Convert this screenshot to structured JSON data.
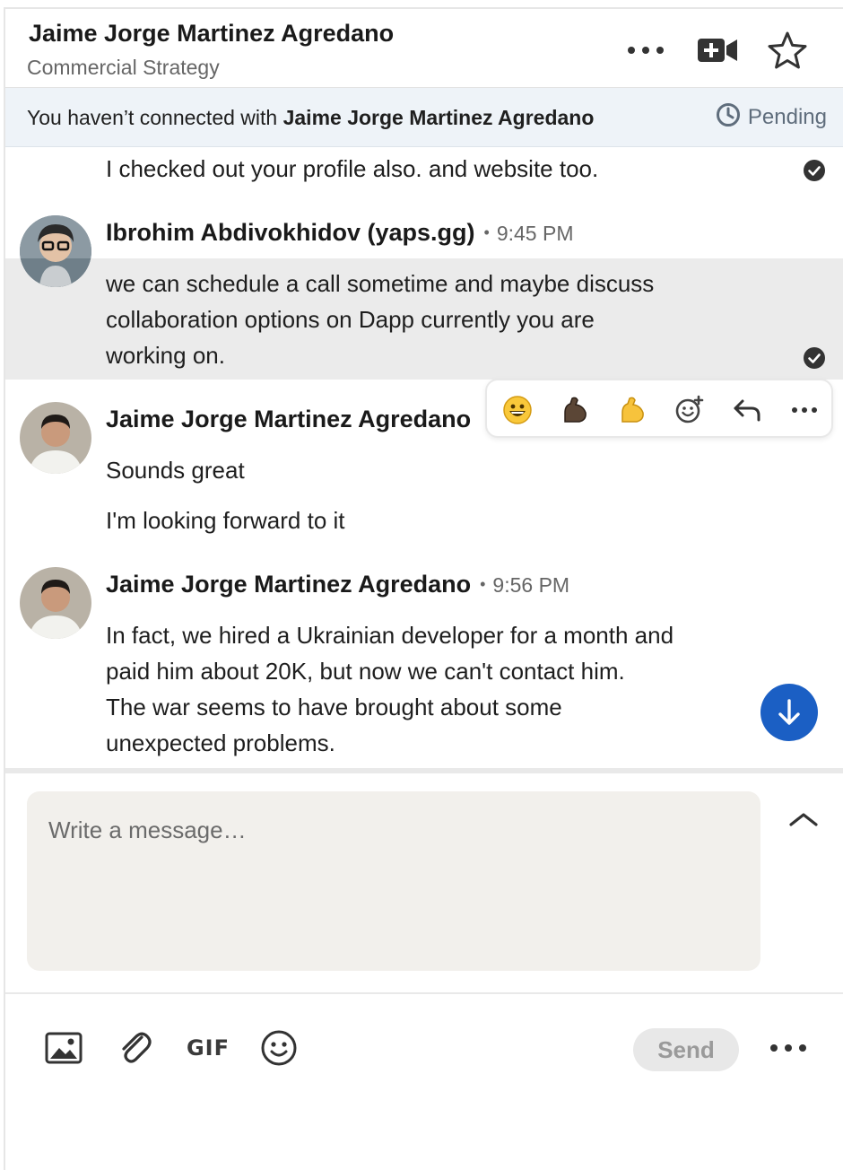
{
  "header": {
    "name": "Jaime Jorge Martinez Agredano",
    "subtitle": "Commercial Strategy",
    "icons": [
      "more-options-icon",
      "video-call-icon",
      "star-icon"
    ]
  },
  "banner": {
    "prefix": "You haven’t connected with ",
    "name": "Jaime Jorge Martinez Agredano",
    "pending_label": "Pending"
  },
  "messages": [
    {
      "text": "I checked out your profile also. and website too.",
      "status": "seen"
    },
    {
      "sender": "Ibrohim Abdivokhidov (yaps.gg)",
      "time": "9:45 PM",
      "lines": [
        "we can schedule a call sometime and maybe discuss",
        "collaboration options on Dapp currently you are",
        "working on."
      ],
      "status": "seen"
    },
    {
      "sender": "Jaime Jorge Martinez Agredano",
      "lines": [
        "Sounds great",
        "I'm looking forward to it"
      ]
    },
    {
      "sender": "Jaime Jorge Martinez Agredano",
      "time": "9:56 PM",
      "lines": [
        "In fact, we hired a Ukrainian developer for a month and",
        "paid him about 20K, but now we can't contact him.",
        "The war seems to have brought about some",
        "unexpected problems."
      ]
    }
  ],
  "reactions": [
    "grinning-face-emoji",
    "flexed-biceps-dark-emoji",
    "flexed-biceps-emoji",
    "add-reaction-icon",
    "reply-icon",
    "more-icon"
  ],
  "compose": {
    "placeholder": "Write a message…",
    "send_label": "Send",
    "gif_label": "GIF"
  },
  "colors": {
    "accent": "#1b5fc4",
    "banner_bg": "#eef3f8",
    "highlight_bg": "#ebebeb",
    "compose_bg": "#f2f0ec"
  }
}
